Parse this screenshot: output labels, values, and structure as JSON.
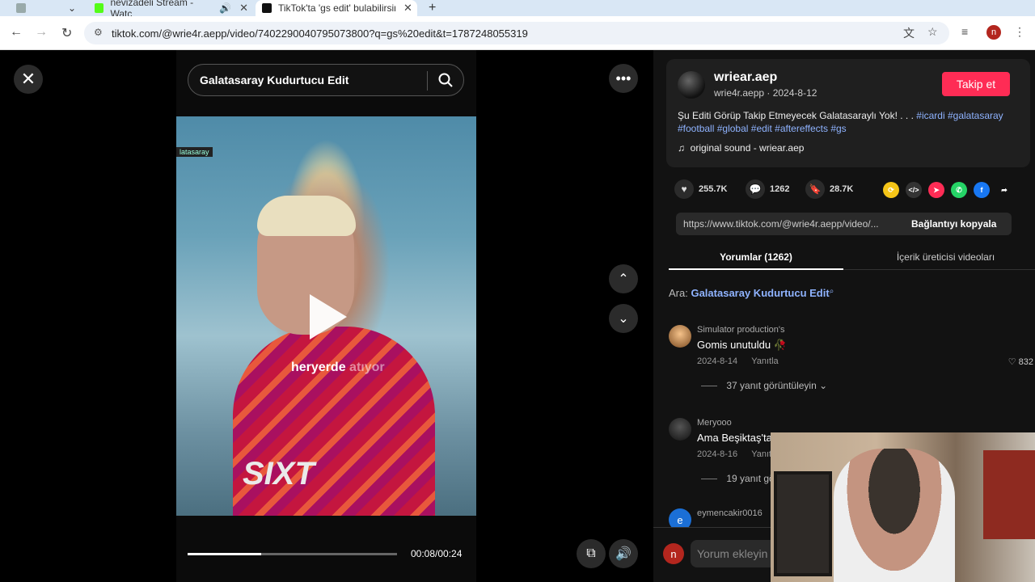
{
  "browser": {
    "tabs": [
      {
        "title": "nevizadeli Stream - Watc",
        "audio": "🔊"
      },
      {
        "title": "TikTok'ta 'gs edit' bulabilirsin"
      }
    ],
    "new_tab": "+",
    "url": "tiktok.com/@wrie4r.aepp/video/7402290040795073800?q=gs%20edit&t=1787248055319",
    "profile_initial": "n"
  },
  "player": {
    "search_query": "Galatasaray Kudurtucu Edit",
    "overlay_caption_bright": "heryerde",
    "overlay_caption_dim": "atıyor",
    "corner_tag": "latasaray",
    "sponsor": "SIXT",
    "time": "00:08/00:24",
    "progress": 0.35
  },
  "panel": {
    "username": "wriear.aep",
    "handle_date": "wrie4r.aepp · 2024-8-12",
    "follow_label": "Takip et",
    "description_text": "Şu Editi Görüp Takip Etmeyecek Galatasaraylı Yok! . . . ",
    "hashtags": [
      "#icardi",
      "#galatasaray",
      "#football",
      "#global",
      "#edit",
      "#aftereffects",
      "#gs"
    ],
    "sound": "original sound - wriear.aep",
    "likes": "255.7K",
    "comments_count": "1262",
    "saves": "28.7K",
    "link_text": "https://www.tiktok.com/@wrie4r.aepp/video/...",
    "copy_label": "Bağlantıyı kopyala",
    "tab_comments": "Yorumlar (1262)",
    "tab_creator": "İçerik üreticisi videoları",
    "search_label": "Ara:",
    "search_term": "Galatasaray Kudurtucu Edit",
    "comments": [
      {
        "name": "Simulator production's",
        "text": "Gomis unutuldu 🥀",
        "date": "2024-8-14",
        "reply": "Yanıtla",
        "likes": "832",
        "more": "37 yanıt görüntüleyin"
      },
      {
        "name": "Meryooo",
        "text": "Ama Beşiktaş'ta",
        "date": "2024-8-16",
        "reply": "Yanıtla",
        "more": "19 yanıt gö"
      },
      {
        "name": "eymencakir0016"
      }
    ],
    "comment_placeholder": "Yorum ekleyin"
  }
}
